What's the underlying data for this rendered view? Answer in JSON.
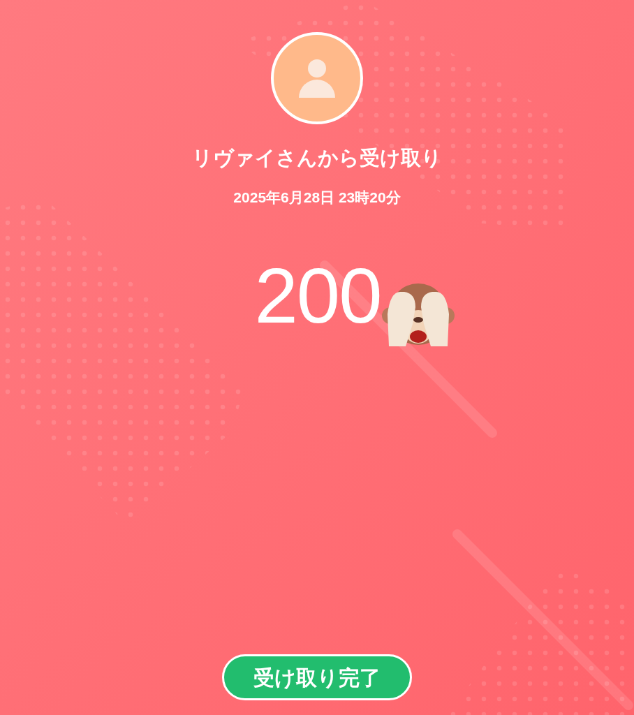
{
  "sender": {
    "message": "リヴァイさんから受け取り",
    "datetime": "2025年6月28日 23時20分"
  },
  "amount": "200",
  "complete_button": "受け取り完了"
}
